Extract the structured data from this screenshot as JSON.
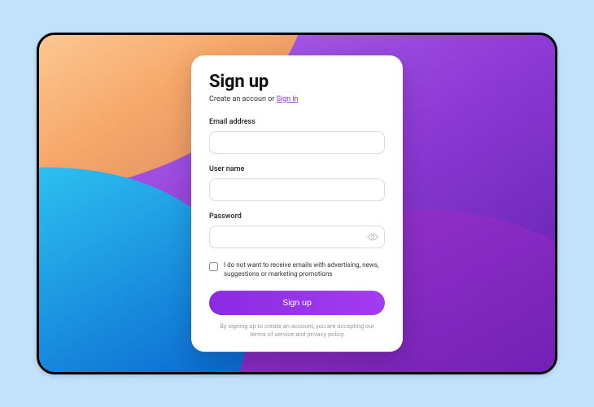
{
  "form": {
    "title": "Sign up",
    "subtitle_prefix": "Create an accoun or  ",
    "signin_link": "Sign in",
    "fields": {
      "email": {
        "label": "Email address",
        "value": ""
      },
      "username": {
        "label": "User name",
        "value": ""
      },
      "password": {
        "label": "Password",
        "value": ""
      }
    },
    "optout_text": "I do not want to receive emails with advertising, news, suggestions or marketing promotions",
    "submit_label": "Sign up",
    "terms_text": "By signing up to create an account, you are accepting our terms of service and privacy policy"
  },
  "colors": {
    "accent": "#8e2ee0",
    "button_start": "#8a2be2",
    "button_end": "#a43cf0"
  }
}
